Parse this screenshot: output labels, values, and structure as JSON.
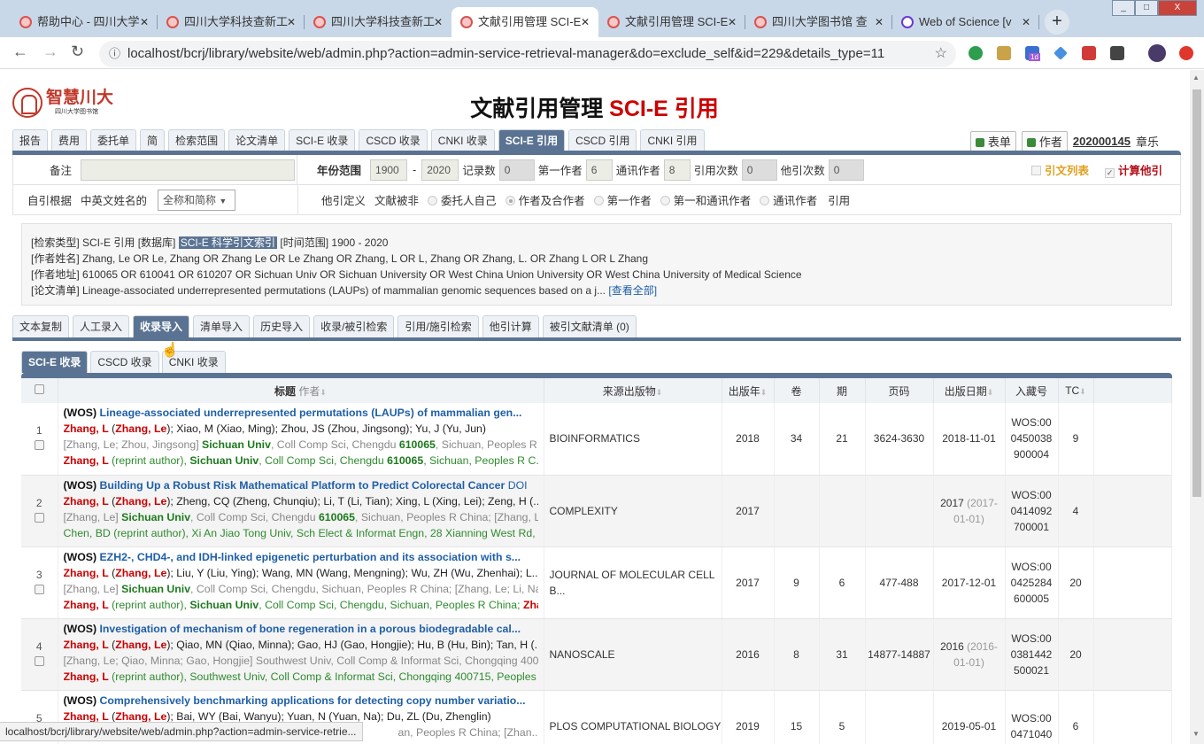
{
  "browser": {
    "tabs": [
      {
        "title": "帮助中心 - 四川大学",
        "active": false
      },
      {
        "title": "四川大学科技查新工",
        "active": false
      },
      {
        "title": "四川大学科技查新工",
        "active": false
      },
      {
        "title": "文献引用管理 SCI-E",
        "active": true
      },
      {
        "title": "文献引用管理 SCI-E",
        "active": false
      },
      {
        "title": "四川大学图书馆 查",
        "active": false
      },
      {
        "title": "Web of Science [v",
        "active": false
      }
    ],
    "url": "localhost/bcrj/library/website/web/admin.php?action=admin-service-retrieval-manager&do=exclude_self&id=229&details_type=11",
    "new_tab": "+",
    "extension_badge": "1d",
    "status_url": "localhost/bcrj/library/website/web/admin.php?action=admin-service-retrie..."
  },
  "header": {
    "logo_text": "智慧川大",
    "logo_sub": "四川大学图书馆",
    "title_black": "文献引用管理",
    "title_red": "SCI-E 引用",
    "form_button": "表单",
    "author_button": "作者",
    "user_id": "202000145",
    "user_name": "章乐"
  },
  "main_tabs": [
    "报告",
    "费用",
    "委托单",
    "简",
    "检索范围",
    "论文清单",
    "SCI-E 收录",
    "CSCD 收录",
    "CNKI 收录",
    "SCI-E 引用",
    "CSCD 引用",
    "CNKI 引用"
  ],
  "main_tab_active": 9,
  "form": {
    "note_label": "备注",
    "note_value": "",
    "year_label": "年份范围",
    "year_from": "1900",
    "year_sep": "-",
    "year_to": "2020",
    "records_label": "记录数",
    "records": "0",
    "first_author_label": "第一作者",
    "first_author": "6",
    "corr_author_label": "通讯作者",
    "corr_author": "8",
    "cite_count_label": "引用次数",
    "cite_count": "0",
    "other_cite_label": "他引次数",
    "other_cite": "0",
    "cite_list_label": "引文列表",
    "cite_list_checked": false,
    "calc_other_label": "计算他引",
    "calc_other_checked": true,
    "self_basis_label": "自引根据",
    "name_label": "中英文姓名的",
    "name_select": "全称和简称",
    "other_def_label": "他引定义",
    "doc_not_label": "文献被非",
    "radios": [
      "委托人自己",
      "作者及合作者",
      "第一作者",
      "第一和通讯作者",
      "通讯作者"
    ],
    "radio_selected": 1,
    "cite_suffix": "引用"
  },
  "info": {
    "type_key": "[检索类型]",
    "type_val": "SCI-E 引用",
    "db_key": "[数据库]",
    "db_val": "SCI-E 科学引文索引",
    "range_key": "[时间范围]",
    "range_val": "1900 - 2020",
    "name_key": "[作者姓名]",
    "name_val": "Zhang, Le OR Le, Zhang OR Zhang Le OR Le Zhang OR Zhang, L OR L, Zhang OR Zhang, L. OR Zhang L OR L Zhang",
    "addr_key": "[作者地址]",
    "addr_val": "610065 OR 610041 OR 610207 OR Sichuan Univ OR Sichuan University OR West China Union University OR West China University of Medical Science",
    "list_key": "[论文清单]",
    "list_val": "Lineage-associated underrepresented permutations (LAUPs) of mammalian genomic sequences based on a j...",
    "view_all": "[查看全部]"
  },
  "sec_tabs": [
    "文本复制",
    "人工录入",
    "收录导入",
    "清单导入",
    "历史导入",
    "收录/被引检索",
    "引用/施引检索",
    "他引计算",
    "被引文献清单 (0)"
  ],
  "sec_tab_active": 2,
  "sub_tabs": [
    "SCI-E 收录",
    "CSCD 收录",
    "CNKI 收录"
  ],
  "sub_tab_active": 0,
  "table": {
    "headers": {
      "title": "标题",
      "author": "作者",
      "source": "来源出版物",
      "year": "出版年",
      "vol": "卷",
      "issue": "期",
      "pages": "页码",
      "date": "出版日期",
      "acc": "入藏号",
      "tc": "TC"
    },
    "rows": [
      {
        "n": "1",
        "source": "BIOINFORMATICS",
        "year": "2018",
        "vol": "34",
        "issue": "21",
        "pages": "3624-3630",
        "date": "2018-11-01",
        "date_extra": "",
        "acc": "WOS:00 0450038 900004",
        "tc": "9",
        "lines": [
          [
            [
              "w",
              "(WOS) "
            ],
            [
              "t",
              "Lineage-associated underrepresented permutations (LAUPs) of mammalian gen..."
            ]
          ],
          [
            [
              "r",
              "Zhang, L"
            ],
            [
              "k",
              " ("
            ],
            [
              "r",
              "Zhang, Le"
            ],
            [
              "k",
              "); Xiao, M (Xiao, Ming); Zhou, JS (Zhou, Jingsong); Yu, J (Yu, Jun)"
            ]
          ],
          [
            [
              "g",
              "[Zhang, Le; Zhou, Jingsong] "
            ],
            [
              "G",
              "Sichuan Univ"
            ],
            [
              "g",
              ", Coll Comp Sci, Chengdu "
            ],
            [
              "G",
              "610065"
            ],
            [
              "g",
              ", Sichuan, Peoples R ..."
            ]
          ],
          [
            [
              "r",
              "Zhang, L"
            ],
            [
              "n",
              " (reprint author), "
            ],
            [
              "G",
              "Sichuan Univ"
            ],
            [
              "n",
              ", Coll Comp Sci, Chengdu "
            ],
            [
              "G",
              "610065"
            ],
            [
              "n",
              ", Sichuan, Peoples R C..."
            ]
          ]
        ]
      },
      {
        "n": "2",
        "source": "COMPLEXITY",
        "year": "2017",
        "vol": "",
        "issue": "",
        "pages": "",
        "date": "2017",
        "date_extra": "(2017-01-01)",
        "acc": "WOS:00 0414092 700001",
        "tc": "4",
        "lines": [
          [
            [
              "w",
              "(WOS) "
            ],
            [
              "t",
              "Building Up a Robust Risk Mathematical Platform to Predict Colorectal Cancer"
            ],
            [
              "d",
              " DOI"
            ]
          ],
          [
            [
              "r",
              "Zhang, L"
            ],
            [
              "k",
              " ("
            ],
            [
              "r",
              "Zhang, Le"
            ],
            [
              "k",
              "); Zheng, CQ (Zheng, Chunqiu); Li, T (Li, Tian); Xing, L (Xing, Lei); Zeng, H (..."
            ]
          ],
          [
            [
              "g",
              "[Zhang, Le] "
            ],
            [
              "G",
              "Sichuan Univ"
            ],
            [
              "g",
              ", Coll Comp Sci, Chengdu "
            ],
            [
              "G",
              "610065"
            ],
            [
              "g",
              ", Sichuan, Peoples R China; [Zhang, L..."
            ]
          ],
          [
            [
              "n",
              "Chen, BD (reprint author), Xi An Jiao Tong Univ, Sch Elect & Informat Engn, 28 Xianning West Rd, ..."
            ]
          ]
        ]
      },
      {
        "n": "3",
        "source": "JOURNAL OF MOLECULAR CELL B...",
        "year": "2017",
        "vol": "9",
        "issue": "6",
        "pages": "477-488",
        "date": "2017-12-01",
        "date_extra": "",
        "acc": "WOS:00 0425284 600005",
        "tc": "20",
        "lines": [
          [
            [
              "w",
              "(WOS) "
            ],
            [
              "t",
              "EZH2-, CHD4-, and IDH-linked epigenetic perturbation and its association with s..."
            ]
          ],
          [
            [
              "r",
              "Zhang, L"
            ],
            [
              "k",
              " ("
            ],
            [
              "r",
              "Zhang, Le"
            ],
            [
              "k",
              "); Liu, Y (Liu, Ying); Wang, MN (Wang, Mengning); Wu, ZH (Wu, Zhenhai); L..."
            ]
          ],
          [
            [
              "g",
              "[Zhang, Le] "
            ],
            [
              "G",
              "Sichuan Univ"
            ],
            [
              "g",
              ", Coll Comp Sci, Chengdu, Sichuan, Peoples R China; [Zhang, Le; Li, Na]..."
            ]
          ],
          [
            [
              "r",
              "Zhang, L"
            ],
            [
              "n",
              " (reprint author), "
            ],
            [
              "G",
              "Sichuan Univ"
            ],
            [
              "n",
              ", Coll Comp Sci, Chengdu, Sichuan, Peoples R China; "
            ],
            [
              "r",
              "Zha..."
            ]
          ]
        ]
      },
      {
        "n": "4",
        "source": "NANOSCALE",
        "year": "2016",
        "vol": "8",
        "issue": "31",
        "pages": "14877-14887",
        "date": "2016",
        "date_extra": "(2016-01-01)",
        "acc": "WOS:00 0381442 500021",
        "tc": "20",
        "lines": [
          [
            [
              "w",
              "(WOS) "
            ],
            [
              "t",
              "Investigation of mechanism of bone regeneration in a porous biodegradable cal..."
            ]
          ],
          [
            [
              "r",
              "Zhang, L"
            ],
            [
              "k",
              " ("
            ],
            [
              "r",
              "Zhang, Le"
            ],
            [
              "k",
              "); Qiao, MN (Qiao, Minna); Gao, HJ (Gao, Hongjie); Hu, B (Hu, Bin); Tan, H (..."
            ]
          ],
          [
            [
              "g",
              "[Zhang, Le; Qiao, Minna; Gao, Hongjie] Southwest Univ, Coll Comp & Informat Sci, Chongqing 400..."
            ]
          ],
          [
            [
              "r",
              "Zhang, L"
            ],
            [
              "n",
              " (reprint author), Southwest Univ, Coll Comp & Informat Sci, Chongqing 400715, Peoples ..."
            ]
          ]
        ]
      },
      {
        "n": "5",
        "source": "PLOS COMPUTATIONAL BIOLOGY",
        "year": "2019",
        "vol": "15",
        "issue": "5",
        "pages": "",
        "date": "2019-05-01",
        "date_extra": "",
        "acc": "WOS:00 0471040",
        "tc": "6",
        "lines": [
          [
            [
              "w",
              "(WOS) "
            ],
            [
              "t",
              "Comprehensively benchmarking applications for detecting copy number variatio..."
            ]
          ],
          [
            [
              "r",
              "Zhang, L"
            ],
            [
              "k",
              " ("
            ],
            [
              "r",
              "Zhang, Le"
            ],
            [
              "k",
              "); Bai, WY (Bai, Wanyu); Yuan, N (Yuan, Na); Du, ZL (Du, Zhenglin)"
            ]
          ],
          [
            [
              "g",
              "an, Peoples R China; [Zhan..."
            ]
          ]
        ]
      }
    ]
  }
}
